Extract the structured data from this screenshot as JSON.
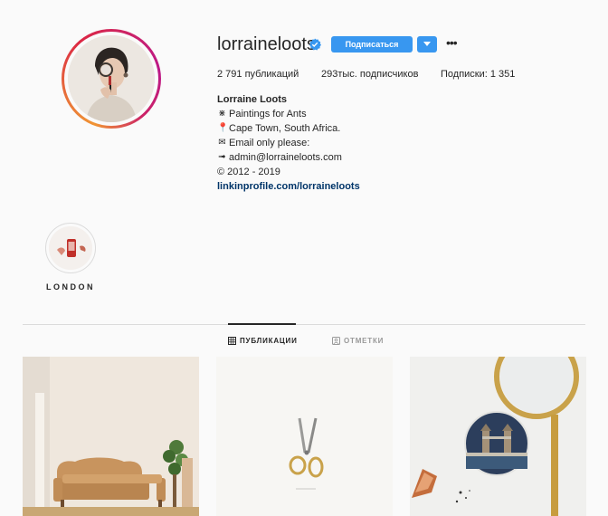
{
  "profile": {
    "username": "lorraineloots",
    "verified_icon": "verified-badge-icon",
    "follow_label": "Подписаться",
    "more_icon": "more-options-icon",
    "stats": {
      "posts": "2 791 публикаций",
      "followers": "293тыс. подписчиков",
      "following": "Подписки: 1 351"
    },
    "bio": {
      "name": "Lorraine Loots",
      "lines": [
        {
          "icon": "ant-icon",
          "text": "Paintings for Ants"
        },
        {
          "icon": "pin-icon",
          "text": "Cape Town, South Africa."
        },
        {
          "icon": "envelope-icon",
          "text": "Email only please:"
        },
        {
          "icon": "arrow-icon",
          "text": "admin@lorraineloots.com"
        }
      ],
      "copyright": "© 2012 - 2019",
      "link": "linkinprofile.com/lorraineloots"
    }
  },
  "highlights": [
    {
      "label": "LONDON"
    }
  ],
  "tabs": {
    "posts": "ПУБЛИКАЦИИ",
    "tagged": "ОТМЕТКИ"
  },
  "colors": {
    "accent": "#3897f0",
    "link": "#003569",
    "text": "#262626",
    "background": "#fafafa"
  }
}
